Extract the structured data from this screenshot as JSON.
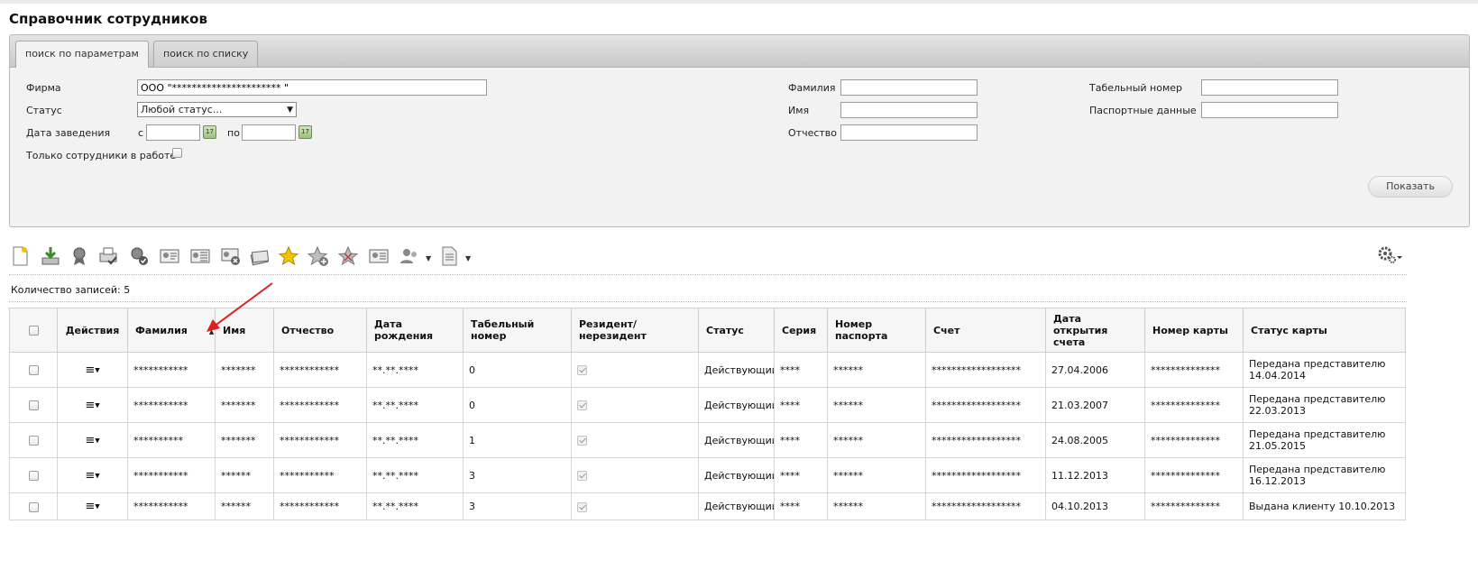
{
  "page": {
    "title": "Справочник сотрудников"
  },
  "search": {
    "tabs": [
      {
        "label": "поиск по параметрам",
        "active": true
      },
      {
        "label": "поиск по списку",
        "active": false
      }
    ],
    "firm_label": "Фирма",
    "firm_value": "ООО \"********************** \"",
    "status_label": "Статус",
    "status_value": "Любой статус...",
    "date_label": "Дата заведения",
    "date_from_label": "с",
    "date_to_label": "по",
    "date_from_value": "",
    "date_to_value": "",
    "calendar_day": "17",
    "only_working_label": "Только сотрудники в работе",
    "lastname_label": "Фамилия",
    "firstname_label": "Имя",
    "patronymic_label": "Отчество",
    "tabnum_label": "Табельный номер",
    "passport_label": "Паспортные данные",
    "show_button": "Показать"
  },
  "toolbar": {
    "icons": [
      "new-document-icon",
      "download-icon",
      "award-icon",
      "print-check-icon",
      "award-check-icon",
      "id-card-icon",
      "id-card-list-icon",
      "id-card-delete-icon",
      "cards-stack-icon",
      "star-icon",
      "star-add-icon",
      "star-remove-icon",
      "id-card-settings-icon",
      "users-dropdown-icon",
      "document-dropdown-icon"
    ],
    "settings_icon": "gear-icon"
  },
  "record_count": "Количество записей: 5",
  "table": {
    "headers": [
      "",
      "Действия",
      "Фамилия",
      "Имя",
      "Отчество",
      "Дата рождения",
      "Табельный номер",
      "Резидент/ нерезидент",
      "Статус",
      "Серия",
      "Номер паспорта",
      "Счет",
      "Дата открытия счета",
      "Номер карты",
      "Статус карты"
    ],
    "rows": [
      {
        "lastname": "***********",
        "firstname": "*******",
        "patronymic": "************",
        "birth": "**.**.****",
        "tabnum": "0",
        "status": "Действующий",
        "series": "****",
        "passport": "******",
        "account": "******************",
        "opened": "27.04.2006",
        "card": "**************",
        "card_status": "Передана представителю 14.04.2014"
      },
      {
        "lastname": "***********",
        "firstname": "*******",
        "patronymic": "************",
        "birth": "**.**.****",
        "tabnum": "0",
        "status": "Действующий",
        "series": "****",
        "passport": "******",
        "account": "******************",
        "opened": "21.03.2007",
        "card": "**************",
        "card_status": "Передана представителю 22.03.2013"
      },
      {
        "lastname": "**********",
        "firstname": "*******",
        "patronymic": "************",
        "birth": "**.**.****",
        "tabnum": "1",
        "status": "Действующий",
        "series": "****",
        "passport": "******",
        "account": "******************",
        "opened": "24.08.2005",
        "card": "**************",
        "card_status": "Передана представителю 21.05.2015"
      },
      {
        "lastname": "***********",
        "firstname": "******",
        "patronymic": "***********",
        "birth": "**.**.****",
        "tabnum": "3",
        "status": "Действующий",
        "series": "****",
        "passport": "******",
        "account": "******************",
        "opened": "11.12.2013",
        "card": "**************",
        "card_status": "Передана представителю 16.12.2013"
      },
      {
        "lastname": "***********",
        "firstname": "******",
        "patronymic": "************",
        "birth": "**.**.****",
        "tabnum": "3",
        "status": "Действующий",
        "series": "****",
        "passport": "******",
        "account": "******************",
        "opened": "04.10.2013",
        "card": "**************",
        "card_status": "Выдана клиенту 10.10.2013"
      }
    ]
  },
  "colors": {
    "annotation_arrow": "#e02020",
    "panel_bg": "#f2f2f2"
  }
}
